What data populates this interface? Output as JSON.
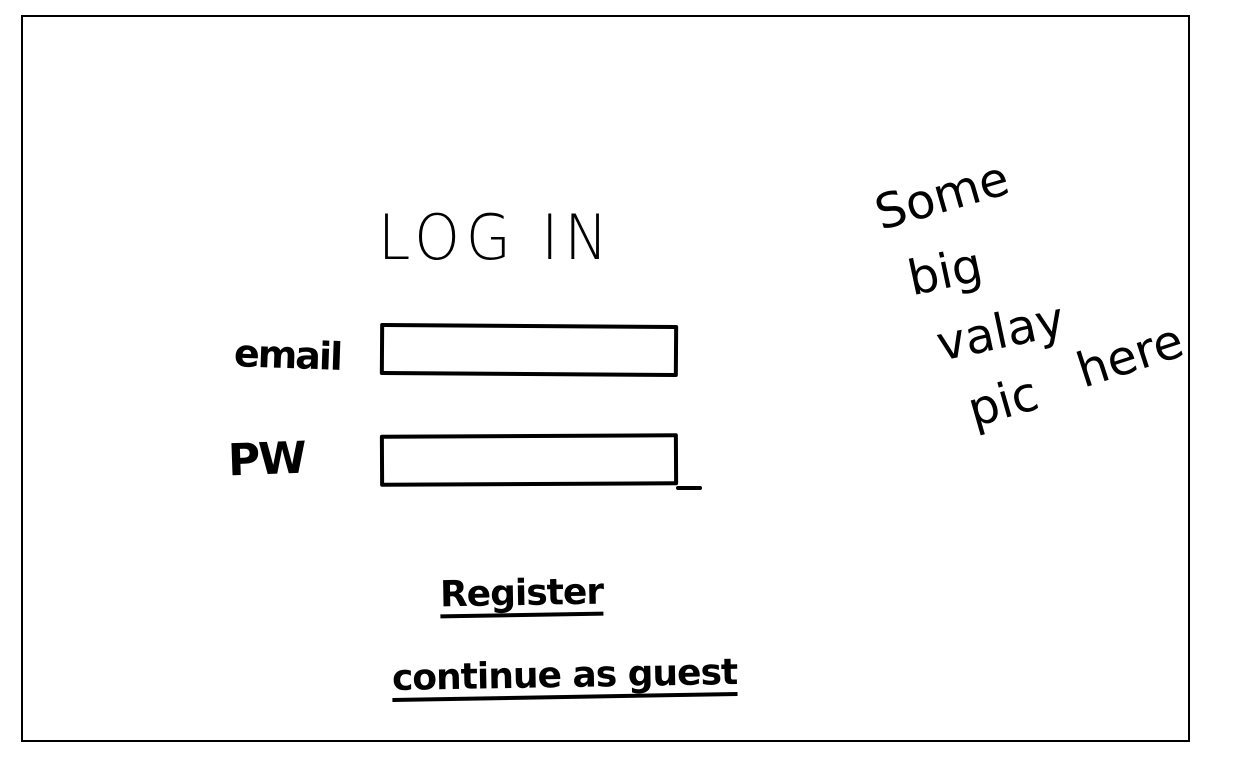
{
  "login": {
    "title": "LOG IN",
    "email_label": "email",
    "password_label": "PW",
    "email_value": "",
    "password_value": "",
    "register_label": "Register",
    "guest_label": "continue as guest"
  },
  "image_note": {
    "line_1": "Some",
    "line_2": "big",
    "line_3": "valay",
    "line_4": "pic",
    "line_5": "here"
  }
}
